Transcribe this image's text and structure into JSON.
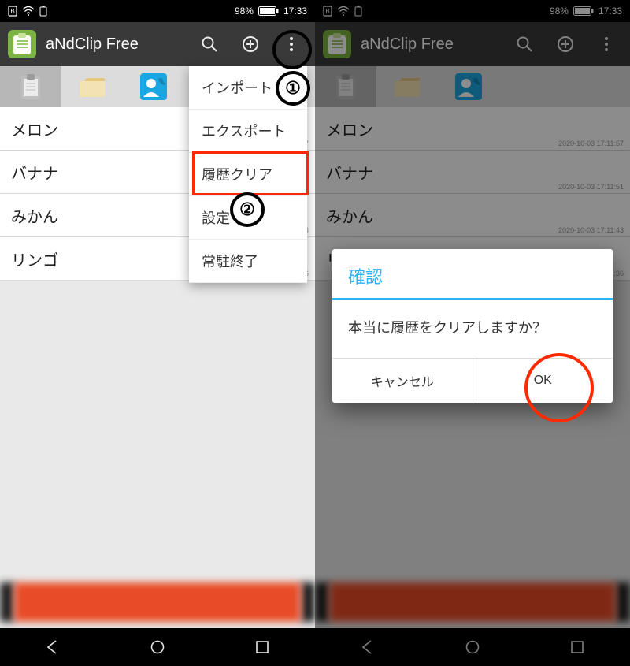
{
  "status": {
    "doc_icon": "B",
    "battery_pct": "98%",
    "time": "17:33"
  },
  "actionbar": {
    "title": "aNdClip Free"
  },
  "tabs": [
    {
      "name": "clipboard"
    },
    {
      "name": "folder"
    },
    {
      "name": "contact"
    }
  ],
  "clips": [
    {
      "text": "メロン",
      "ts": "2020-10-03 17:11:57"
    },
    {
      "text": "バナナ",
      "ts": "2020-10-03 17:11:51"
    },
    {
      "text": "みかん",
      "ts": "2020-10-03 17:11:43"
    },
    {
      "text": "リンゴ",
      "ts": "2020-10-03 17:11:36"
    }
  ],
  "menu": {
    "items": [
      {
        "label": "インポート"
      },
      {
        "label": "エクスポート"
      },
      {
        "label": "履歴クリア"
      },
      {
        "label": "設定"
      },
      {
        "label": "常駐終了"
      }
    ]
  },
  "dialog": {
    "title": "確認",
    "body": "本当に履歴をクリアしますか？",
    "cancel": "キャンセル",
    "ok": "OK"
  },
  "annotations": {
    "badge1": "①",
    "badge2": "②"
  }
}
